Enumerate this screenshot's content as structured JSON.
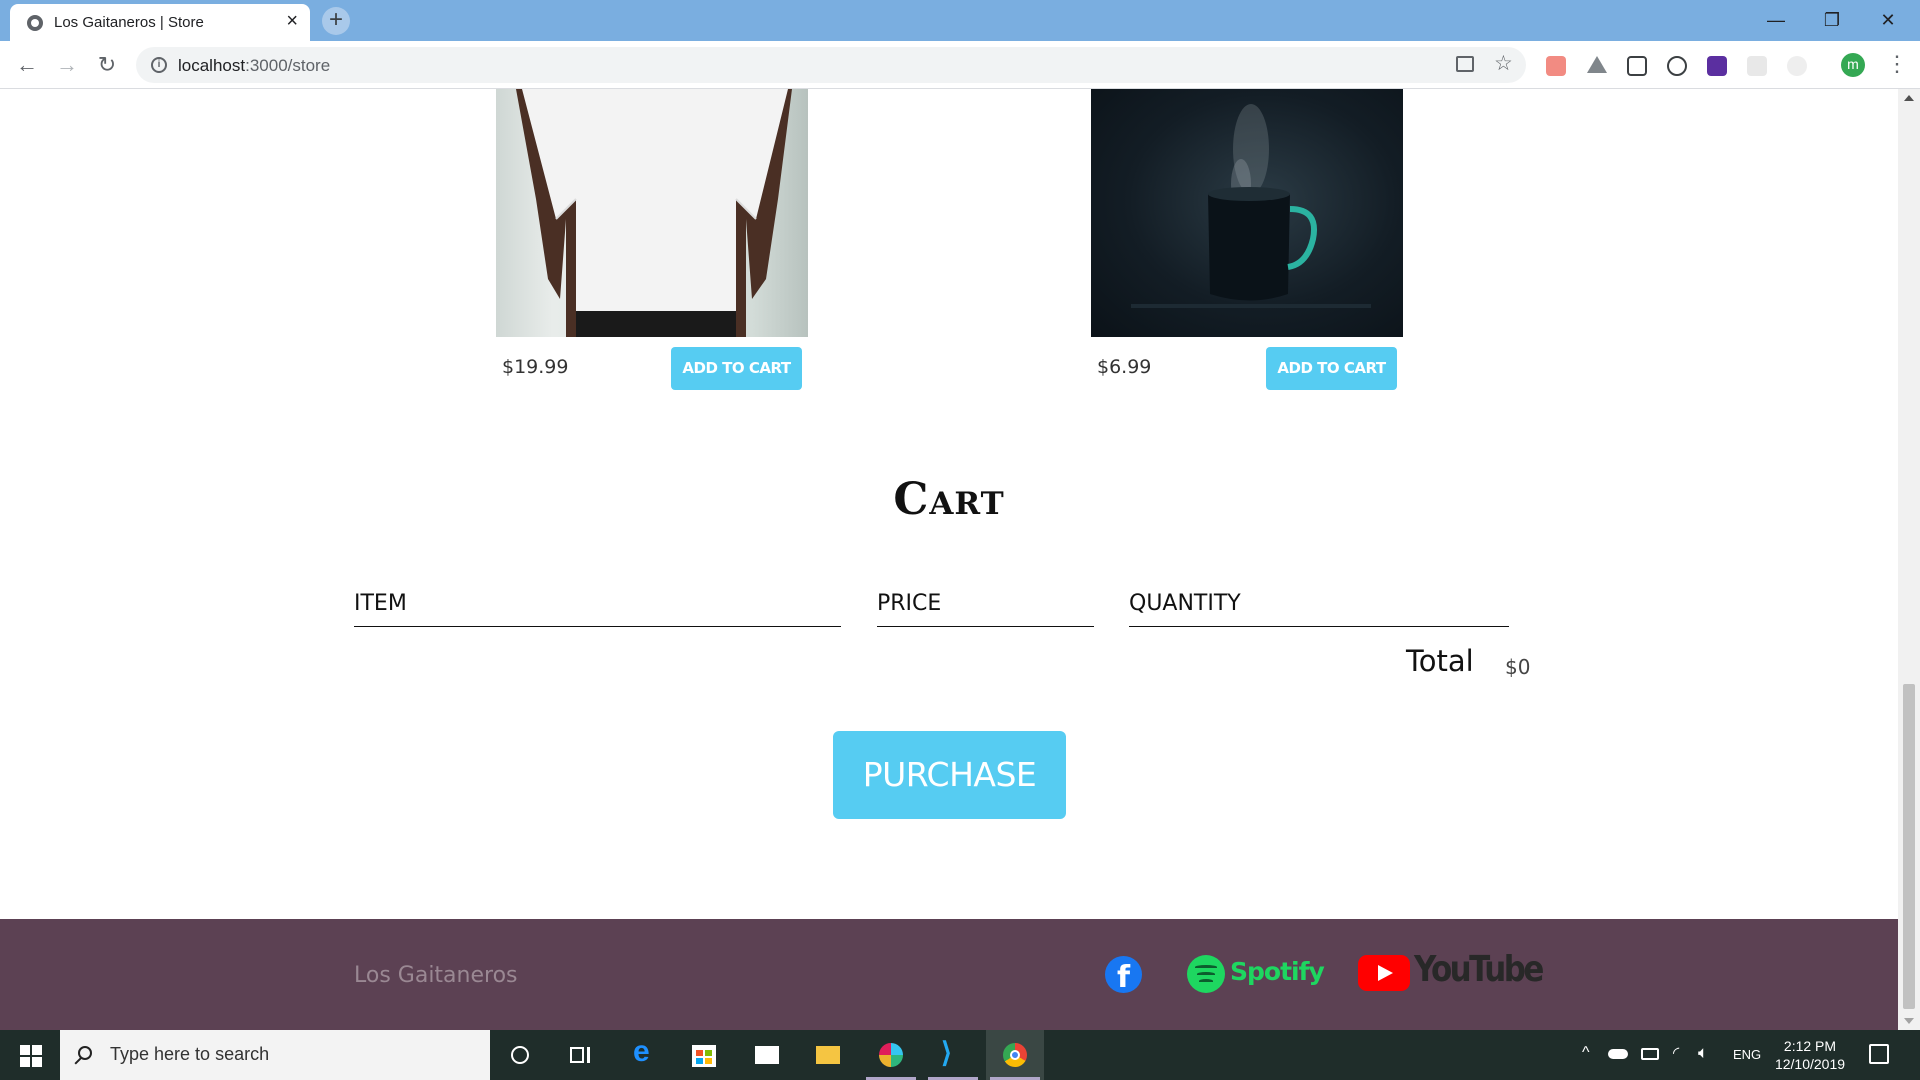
{
  "browser": {
    "tab_title": "Los Gaitaneros | Store",
    "url_host": "localhost",
    "url_rest": ":3000/store",
    "profile_initial": "m"
  },
  "products": [
    {
      "price": "$19.99",
      "button_label": "ADD TO CART",
      "image": "white-tshirt"
    },
    {
      "price": "$6.99",
      "button_label": "ADD TO CART",
      "image": "coffee-mug"
    }
  ],
  "cart": {
    "title": "Cart",
    "columns": {
      "item": "ITEM",
      "price": "PRICE",
      "quantity": "QUANTITY"
    },
    "total_label": "Total",
    "total_value": "$0",
    "purchase_label": "PURCHASE"
  },
  "footer": {
    "brand": "Los Gaitaneros",
    "facebook": "f",
    "spotify": "Spotify",
    "youtube": "YouTube"
  },
  "taskbar": {
    "search_placeholder": "Type here to search",
    "language": "ENG",
    "time": "2:12 PM",
    "date": "12/10/2019"
  },
  "colors": {
    "accent": "#56ccf2",
    "footer_bg": "#5c4153",
    "tabbar": "#7aaee0"
  }
}
